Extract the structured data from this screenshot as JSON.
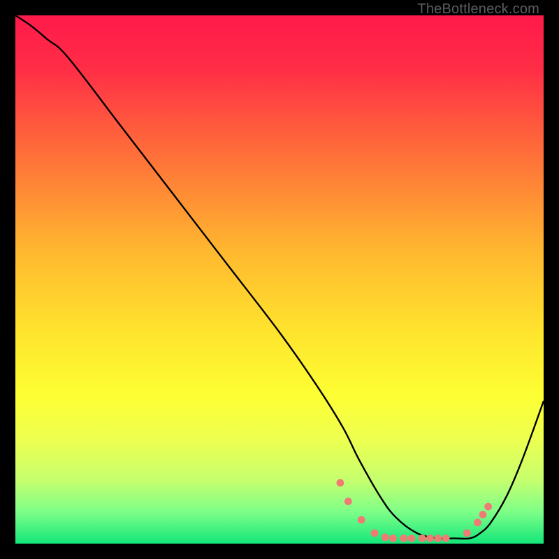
{
  "watermark": "TheBottleneck.com",
  "chart_data": {
    "type": "line",
    "title": "",
    "xlabel": "",
    "ylabel": "",
    "xlim": [
      0,
      100
    ],
    "ylim": [
      0,
      100
    ],
    "background_gradient": {
      "stops": [
        {
          "offset": 0.0,
          "color": "#ff1a4b"
        },
        {
          "offset": 0.1,
          "color": "#ff2d46"
        },
        {
          "offset": 0.25,
          "color": "#ff6a3a"
        },
        {
          "offset": 0.45,
          "color": "#ffb92f"
        },
        {
          "offset": 0.6,
          "color": "#ffe42e"
        },
        {
          "offset": 0.72,
          "color": "#fdff33"
        },
        {
          "offset": 0.8,
          "color": "#eeff4f"
        },
        {
          "offset": 0.88,
          "color": "#c6ff6e"
        },
        {
          "offset": 0.94,
          "color": "#7dff88"
        },
        {
          "offset": 1.0,
          "color": "#14e67a"
        }
      ]
    },
    "series": [
      {
        "name": "curve",
        "color": "#000000",
        "x": [
          0,
          3,
          6,
          10,
          20,
          30,
          40,
          50,
          57,
          62,
          65,
          69,
          72,
          76,
          80,
          83,
          86,
          88,
          90,
          93,
          96,
          100
        ],
        "y": [
          100,
          98,
          95.5,
          92,
          79,
          66,
          53,
          40,
          30,
          22,
          16,
          9,
          5,
          2,
          1,
          1,
          1,
          2,
          4,
          9,
          16,
          27
        ]
      }
    ],
    "markers": {
      "color": "#ef7b75",
      "radius": 5.4,
      "points": [
        {
          "x": 61.5,
          "y": 11.5
        },
        {
          "x": 63.0,
          "y": 8.0
        },
        {
          "x": 65.5,
          "y": 4.5
        },
        {
          "x": 68.0,
          "y": 2.0
        },
        {
          "x": 70.0,
          "y": 1.2
        },
        {
          "x": 71.5,
          "y": 1.0
        },
        {
          "x": 73.5,
          "y": 1.0
        },
        {
          "x": 75.0,
          "y": 1.0
        },
        {
          "x": 77.0,
          "y": 1.0
        },
        {
          "x": 78.5,
          "y": 1.0
        },
        {
          "x": 80.0,
          "y": 1.0
        },
        {
          "x": 81.5,
          "y": 1.0
        },
        {
          "x": 85.5,
          "y": 2.0
        },
        {
          "x": 87.5,
          "y": 4.0
        },
        {
          "x": 88.5,
          "y": 5.5
        },
        {
          "x": 89.5,
          "y": 7.0
        }
      ]
    }
  }
}
